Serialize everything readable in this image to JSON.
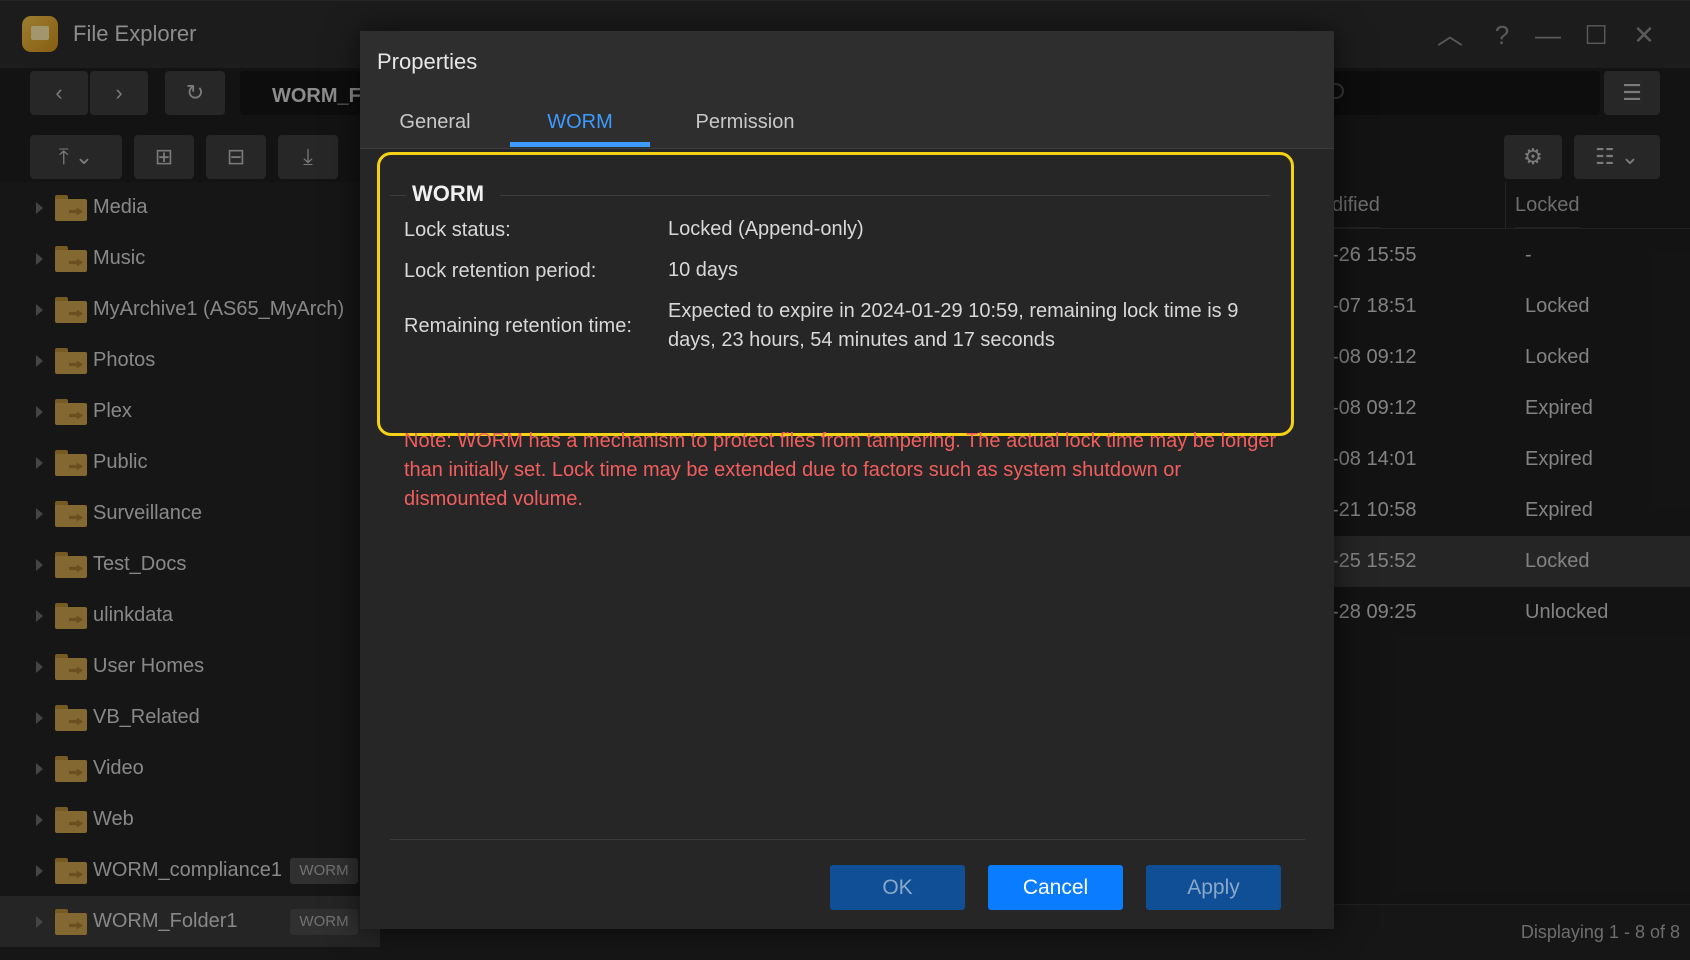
{
  "window": {
    "title": "File Explorer",
    "address": "WORM_F"
  },
  "sidebar": {
    "items": [
      {
        "label": "Media",
        "badge": ""
      },
      {
        "label": "Music",
        "badge": ""
      },
      {
        "label": "MyArchive1 (AS65_MyArch)",
        "badge": ""
      },
      {
        "label": "Photos",
        "badge": ""
      },
      {
        "label": "Plex",
        "badge": ""
      },
      {
        "label": "Public",
        "badge": ""
      },
      {
        "label": "Surveillance",
        "badge": ""
      },
      {
        "label": "Test_Docs",
        "badge": ""
      },
      {
        "label": "ulinkdata",
        "badge": ""
      },
      {
        "label": "User Homes",
        "badge": ""
      },
      {
        "label": "VB_Related",
        "badge": ""
      },
      {
        "label": "Video",
        "badge": ""
      },
      {
        "label": "Web",
        "badge": ""
      },
      {
        "label": "WORM_compliance1",
        "badge": "WORM"
      },
      {
        "label": "WORM_Folder1",
        "badge": "WORM"
      }
    ]
  },
  "filelist": {
    "columns": {
      "modified": "dified",
      "locked": "Locked"
    },
    "rows": [
      {
        "modified": "-26 15:55",
        "locked": "-"
      },
      {
        "modified": "-07 18:51",
        "locked": "Locked"
      },
      {
        "modified": "-08 09:12",
        "locked": "Locked"
      },
      {
        "modified": "-08 09:12",
        "locked": "Expired"
      },
      {
        "modified": "-08 14:01",
        "locked": "Expired"
      },
      {
        "modified": "-21 10:58",
        "locked": "Expired"
      },
      {
        "modified": "-25 15:52",
        "locked": "Locked"
      },
      {
        "modified": "-28 09:25",
        "locked": "Unlocked"
      }
    ],
    "status": "Displaying 1 - 8 of 8"
  },
  "dialog": {
    "title": "Properties",
    "tabs": [
      "General",
      "WORM",
      "Permission"
    ],
    "active_tab": "WORM",
    "section_title": "WORM",
    "lock_status_label": "Lock status:",
    "lock_status_value": "Locked (Append-only)",
    "retention_label": "Lock retention period:",
    "retention_value": "10 days",
    "remaining_label": "Remaining retention time:",
    "remaining_value": "Expected to expire in 2024-01-29 10:59, remaining lock time is 9 days, 23 hours, 54 minutes and 17 seconds",
    "note": "Note: WORM has a mechanism to protect files from tampering. The actual lock time may be longer than initially set. Lock time may be extended due to factors such as system shutdown or dismounted volume.",
    "ok_label": "OK",
    "cancel_label": "Cancel",
    "apply_label": "Apply"
  },
  "colors": {
    "accent": "#3d9bff",
    "highlight_box": "#f5d215",
    "note_text": "#f15e5e",
    "primary_button": "#0a7cff"
  }
}
